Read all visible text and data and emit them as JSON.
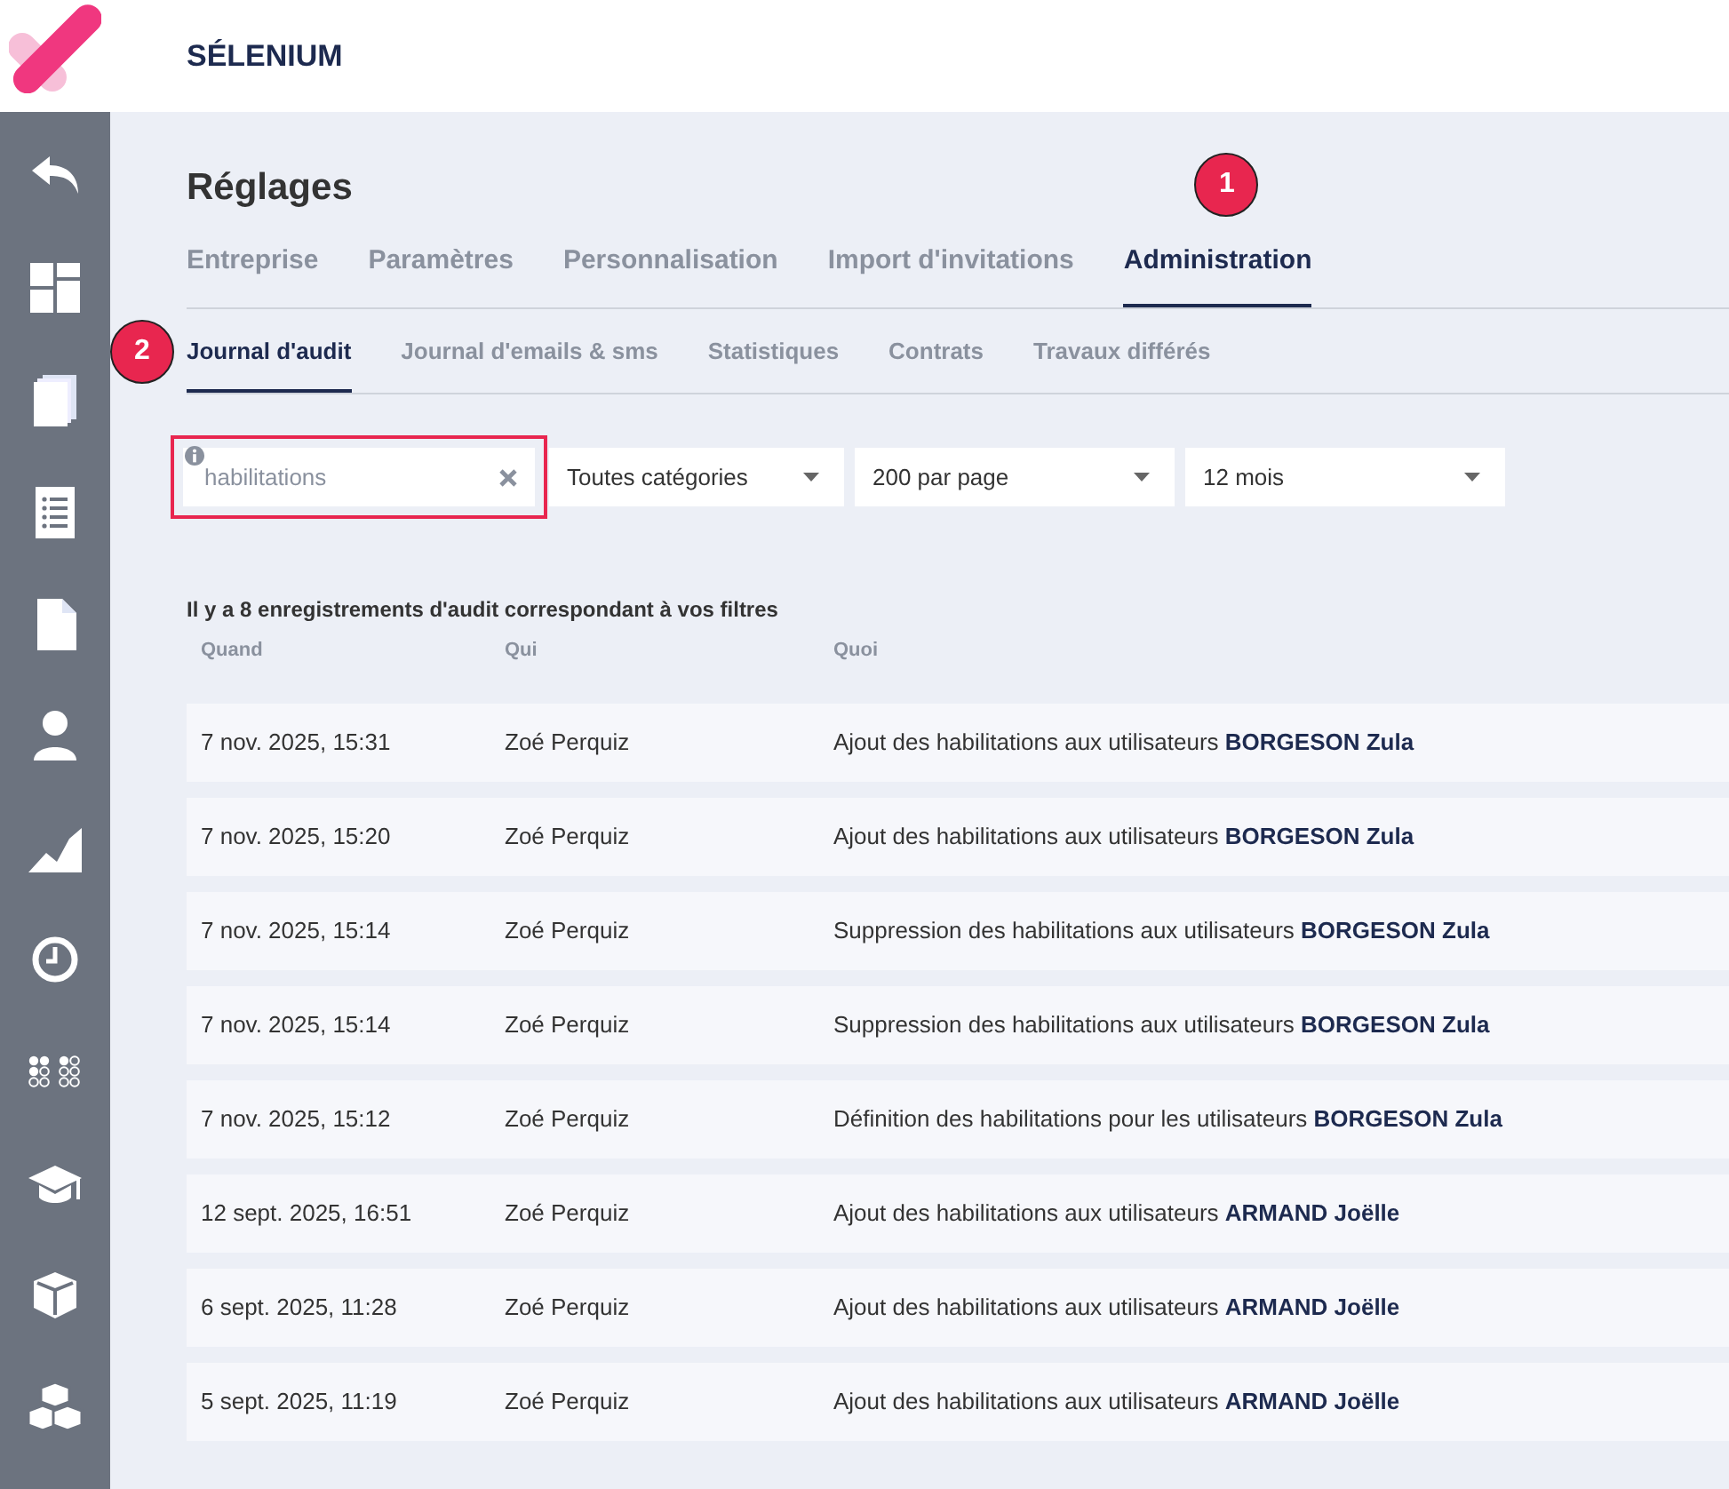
{
  "header": {
    "title": "SÉLENIUM"
  },
  "page": {
    "title": "Réglages"
  },
  "tabs": [
    {
      "label": "Entreprise",
      "selected": false
    },
    {
      "label": "Paramètres",
      "selected": false
    },
    {
      "label": "Personnalisation",
      "selected": false
    },
    {
      "label": "Import d'invitations",
      "selected": false
    },
    {
      "label": "Administration",
      "selected": true,
      "marker": "1"
    }
  ],
  "subtabs": [
    {
      "label": "Journal d'audit",
      "selected": true,
      "marker": "2"
    },
    {
      "label": "Journal d'emails & sms",
      "selected": false
    },
    {
      "label": "Statistiques",
      "selected": false
    },
    {
      "label": "Contrats",
      "selected": false
    },
    {
      "label": "Travaux différés",
      "selected": false
    }
  ],
  "filters": {
    "search": {
      "value": "habilitations",
      "highlighted": true
    },
    "selects": [
      {
        "value": "Toutes catégories"
      },
      {
        "value": "200 par page"
      },
      {
        "value": "12 mois"
      }
    ]
  },
  "summary": "Il y a 8 enregistrements d'audit correspondant à vos filtres",
  "table": {
    "columns": [
      "Quand",
      "Qui",
      "Quoi"
    ],
    "rows": [
      {
        "when": "7 nov. 2025, 15:31",
        "who": "Zoé Perquiz",
        "what": "Ajout des habilitations aux utilisateurs **BORGESON Zula**"
      },
      {
        "when": "7 nov. 2025, 15:20",
        "who": "Zoé Perquiz",
        "what": "Ajout des habilitations aux utilisateurs **BORGESON Zula**"
      },
      {
        "when": "7 nov. 2025, 15:14",
        "who": "Zoé Perquiz",
        "what": "Suppression des habilitations aux utilisateurs **BORGESON Zula**"
      },
      {
        "when": "7 nov. 2025, 15:14",
        "who": "Zoé Perquiz",
        "what": "Suppression des habilitations aux utilisateurs **BORGESON Zula**"
      },
      {
        "when": "7 nov. 2025, 15:12",
        "who": "Zoé Perquiz",
        "what": "Définition des habilitations pour les utilisateurs **BORGESON Zula**"
      },
      {
        "when": "12 sept. 2025, 16:51",
        "who": "Zoé Perquiz",
        "what": "Ajout des habilitations aux utilisateurs **ARMAND Joëlle**"
      },
      {
        "when": "6 sept. 2025, 11:28",
        "who": "Zoé Perquiz",
        "what": "Ajout des habilitations aux utilisateurs **ARMAND Joëlle**"
      },
      {
        "when": "5 sept. 2025, 11:19",
        "who": "Zoé Perquiz",
        "what": "Ajout des habilitations aux utilisateurs **ARMAND Joëlle**"
      }
    ]
  }
}
